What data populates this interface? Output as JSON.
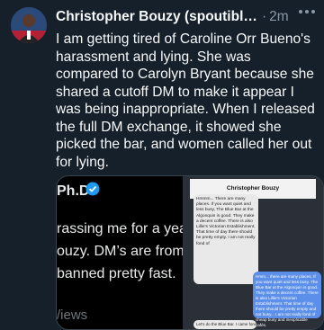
{
  "tweet": {
    "author_name": "Christopher Bouzy (spoutible....",
    "separator": "·",
    "time": "2m",
    "text": "I am getting tired of Caroline Orr Bueno's harassment and lying. She was compared to Carolyn Bryant because she shared a cutoff DM to make it appear I was being inappropriate. When I released the full DM exchange, it showed she picked the bar, and women called her out for lying."
  },
  "media": {
    "left_panel": {
      "title_fragment": "Ph.D",
      "lines": [
        "rassing me for a year a",
        "ouzy. DM’s are from ra",
        " banned pretty fast."
      ],
      "views": "/iews"
    },
    "dm_screenshot": {
      "header_name": "Christopher Bouzy",
      "gray_message": "Hmmm... There are many places. If you want quiet and less busy, The Blue Bar at the Algonquin is good. They make a decent coffee. There is also Lillie's Victorian Establishment. That time of day there should be pretty empty. I am not really fond of",
      "blue_message": "Hmm... there are many places. If you want quiet and less busy. The Blue Bar at the Algonquin is good. They make a decent coffee. There is also Lillie's Victorian Establishment. That time of day there should be pretty empty and not busy... I am not really fond of cheap busy and inexplicable cafés.",
      "bottom_message": "Let's do the Blue Bar. I came fond of non-so-busy :)"
    }
  },
  "colors": {
    "background": "#15202b",
    "text_primary": "#f7f9f9",
    "text_secondary": "#8b98a5",
    "verified_blue": "#1d9bf0",
    "dm_blue": "#5b8fe9"
  }
}
